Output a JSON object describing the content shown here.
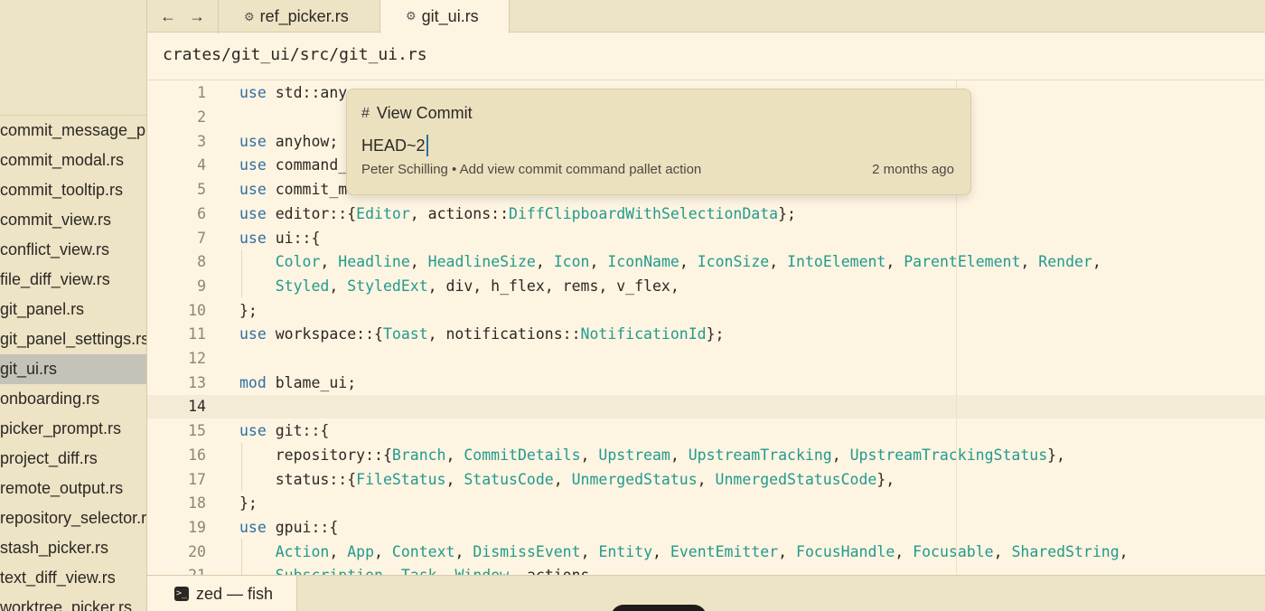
{
  "tabs": [
    {
      "label": "ref_picker.rs",
      "active": false
    },
    {
      "label": "git_ui.rs",
      "active": true
    }
  ],
  "nav": {
    "back": "←",
    "forward": "→"
  },
  "breadcrumb": "crates/git_ui/src/git_ui.rs",
  "sidebar": {
    "files": [
      "commit_message_prompt.txt",
      "commit_modal.rs",
      "commit_tooltip.rs",
      "commit_view.rs",
      "conflict_view.rs",
      "file_diff_view.rs",
      "git_panel.rs",
      "git_panel_settings.rs",
      "git_ui.rs",
      "onboarding.rs",
      "picker_prompt.rs",
      "project_diff.rs",
      "remote_output.rs",
      "repository_selector.rs",
      "stash_picker.rs",
      "text_diff_view.rs",
      "worktree_picker.rs"
    ],
    "selected_index": 8
  },
  "editor": {
    "current_line": 14,
    "lines": [
      {
        "n": "1",
        "tokens": [
          [
            "kw",
            "use"
          ],
          [
            "p",
            " std::any"
          ]
        ]
      },
      {
        "n": "2",
        "tokens": []
      },
      {
        "n": "3",
        "tokens": [
          [
            "kw",
            "use"
          ],
          [
            "p",
            " anyhow;"
          ]
        ]
      },
      {
        "n": "4",
        "tokens": [
          [
            "kw",
            "use"
          ],
          [
            "p",
            " command_"
          ]
        ]
      },
      {
        "n": "5",
        "tokens": [
          [
            "kw",
            "use"
          ],
          [
            "p",
            " commit_m"
          ]
        ]
      },
      {
        "n": "6",
        "tokens": [
          [
            "kw",
            "use"
          ],
          [
            "p",
            " editor::{"
          ],
          [
            "ty",
            "Editor"
          ],
          [
            "p",
            ", actions::"
          ],
          [
            "ty",
            "DiffClipboardWithSelectionData"
          ],
          [
            "p",
            "};"
          ]
        ]
      },
      {
        "n": "7",
        "tokens": [
          [
            "kw",
            "use"
          ],
          [
            "p",
            " ui::{"
          ]
        ]
      },
      {
        "n": "8",
        "tokens": [
          [
            "p",
            "    "
          ],
          [
            "ty",
            "Color"
          ],
          [
            "p",
            ", "
          ],
          [
            "ty",
            "Headline"
          ],
          [
            "p",
            ", "
          ],
          [
            "ty",
            "HeadlineSize"
          ],
          [
            "p",
            ", "
          ],
          [
            "ty",
            "Icon"
          ],
          [
            "p",
            ", "
          ],
          [
            "ty",
            "IconName"
          ],
          [
            "p",
            ", "
          ],
          [
            "ty",
            "IconSize"
          ],
          [
            "p",
            ", "
          ],
          [
            "ty",
            "IntoElement"
          ],
          [
            "p",
            ", "
          ],
          [
            "ty",
            "ParentElement"
          ],
          [
            "p",
            ", "
          ],
          [
            "ty",
            "Render"
          ],
          [
            "p",
            ","
          ]
        ]
      },
      {
        "n": "9",
        "tokens": [
          [
            "p",
            "    "
          ],
          [
            "ty",
            "Styled"
          ],
          [
            "p",
            ", "
          ],
          [
            "ty",
            "StyledExt"
          ],
          [
            "p",
            ", div, h_flex, rems, v_flex,"
          ]
        ]
      },
      {
        "n": "10",
        "tokens": [
          [
            "p",
            "};"
          ]
        ]
      },
      {
        "n": "11",
        "tokens": [
          [
            "kw",
            "use"
          ],
          [
            "p",
            " workspace::{"
          ],
          [
            "ty",
            "Toast"
          ],
          [
            "p",
            ", notifications::"
          ],
          [
            "ty",
            "NotificationId"
          ],
          [
            "p",
            "};"
          ]
        ]
      },
      {
        "n": "12",
        "tokens": []
      },
      {
        "n": "13",
        "tokens": [
          [
            "kw",
            "mod"
          ],
          [
            "p",
            " blame_ui;"
          ]
        ]
      },
      {
        "n": "14",
        "tokens": []
      },
      {
        "n": "15",
        "tokens": [
          [
            "kw",
            "use"
          ],
          [
            "p",
            " git::{"
          ]
        ]
      },
      {
        "n": "16",
        "tokens": [
          [
            "p",
            "    repository::{"
          ],
          [
            "ty",
            "Branch"
          ],
          [
            "p",
            ", "
          ],
          [
            "ty",
            "CommitDetails"
          ],
          [
            "p",
            ", "
          ],
          [
            "ty",
            "Upstream"
          ],
          [
            "p",
            ", "
          ],
          [
            "ty",
            "UpstreamTracking"
          ],
          [
            "p",
            ", "
          ],
          [
            "ty",
            "UpstreamTrackingStatus"
          ],
          [
            "p",
            "},"
          ]
        ]
      },
      {
        "n": "17",
        "tokens": [
          [
            "p",
            "    status::{"
          ],
          [
            "ty",
            "FileStatus"
          ],
          [
            "p",
            ", "
          ],
          [
            "ty",
            "StatusCode"
          ],
          [
            "p",
            ", "
          ],
          [
            "ty",
            "UnmergedStatus"
          ],
          [
            "p",
            ", "
          ],
          [
            "ty",
            "UnmergedStatusCode"
          ],
          [
            "p",
            "},"
          ]
        ]
      },
      {
        "n": "18",
        "tokens": [
          [
            "p",
            "};"
          ]
        ]
      },
      {
        "n": "19",
        "tokens": [
          [
            "kw",
            "use"
          ],
          [
            "p",
            " gpui::{"
          ]
        ]
      },
      {
        "n": "20",
        "tokens": [
          [
            "p",
            "    "
          ],
          [
            "ty",
            "Action"
          ],
          [
            "p",
            ", "
          ],
          [
            "ty",
            "App"
          ],
          [
            "p",
            ", "
          ],
          [
            "ty",
            "Context"
          ],
          [
            "p",
            ", "
          ],
          [
            "ty",
            "DismissEvent"
          ],
          [
            "p",
            ", "
          ],
          [
            "ty",
            "Entity"
          ],
          [
            "p",
            ", "
          ],
          [
            "ty",
            "EventEmitter"
          ],
          [
            "p",
            ", "
          ],
          [
            "ty",
            "FocusHandle"
          ],
          [
            "p",
            ", "
          ],
          [
            "ty",
            "Focusable"
          ],
          [
            "p",
            ", "
          ],
          [
            "ty",
            "SharedString"
          ],
          [
            "p",
            ","
          ]
        ]
      },
      {
        "n": "21",
        "tokens": [
          [
            "p",
            "    "
          ],
          [
            "ty",
            "Subscription"
          ],
          [
            "p",
            ", "
          ],
          [
            "ty",
            "Task"
          ],
          [
            "p",
            ", "
          ],
          [
            "ty",
            "Window"
          ],
          [
            "p",
            ", actions,"
          ]
        ]
      }
    ]
  },
  "popup": {
    "icon": "#",
    "title": "View Commit",
    "input_value": "HEAD~2",
    "meta": "Peter Schilling • Add view commit command pallet action",
    "age": "2 months ago"
  },
  "terminal": {
    "label": "zed — fish",
    "icon": ">_"
  },
  "colors": {
    "keyword": "#2f6fa3",
    "type": "#229a8e",
    "background": "#fdf4e1",
    "sidebar": "#ede3c5"
  }
}
